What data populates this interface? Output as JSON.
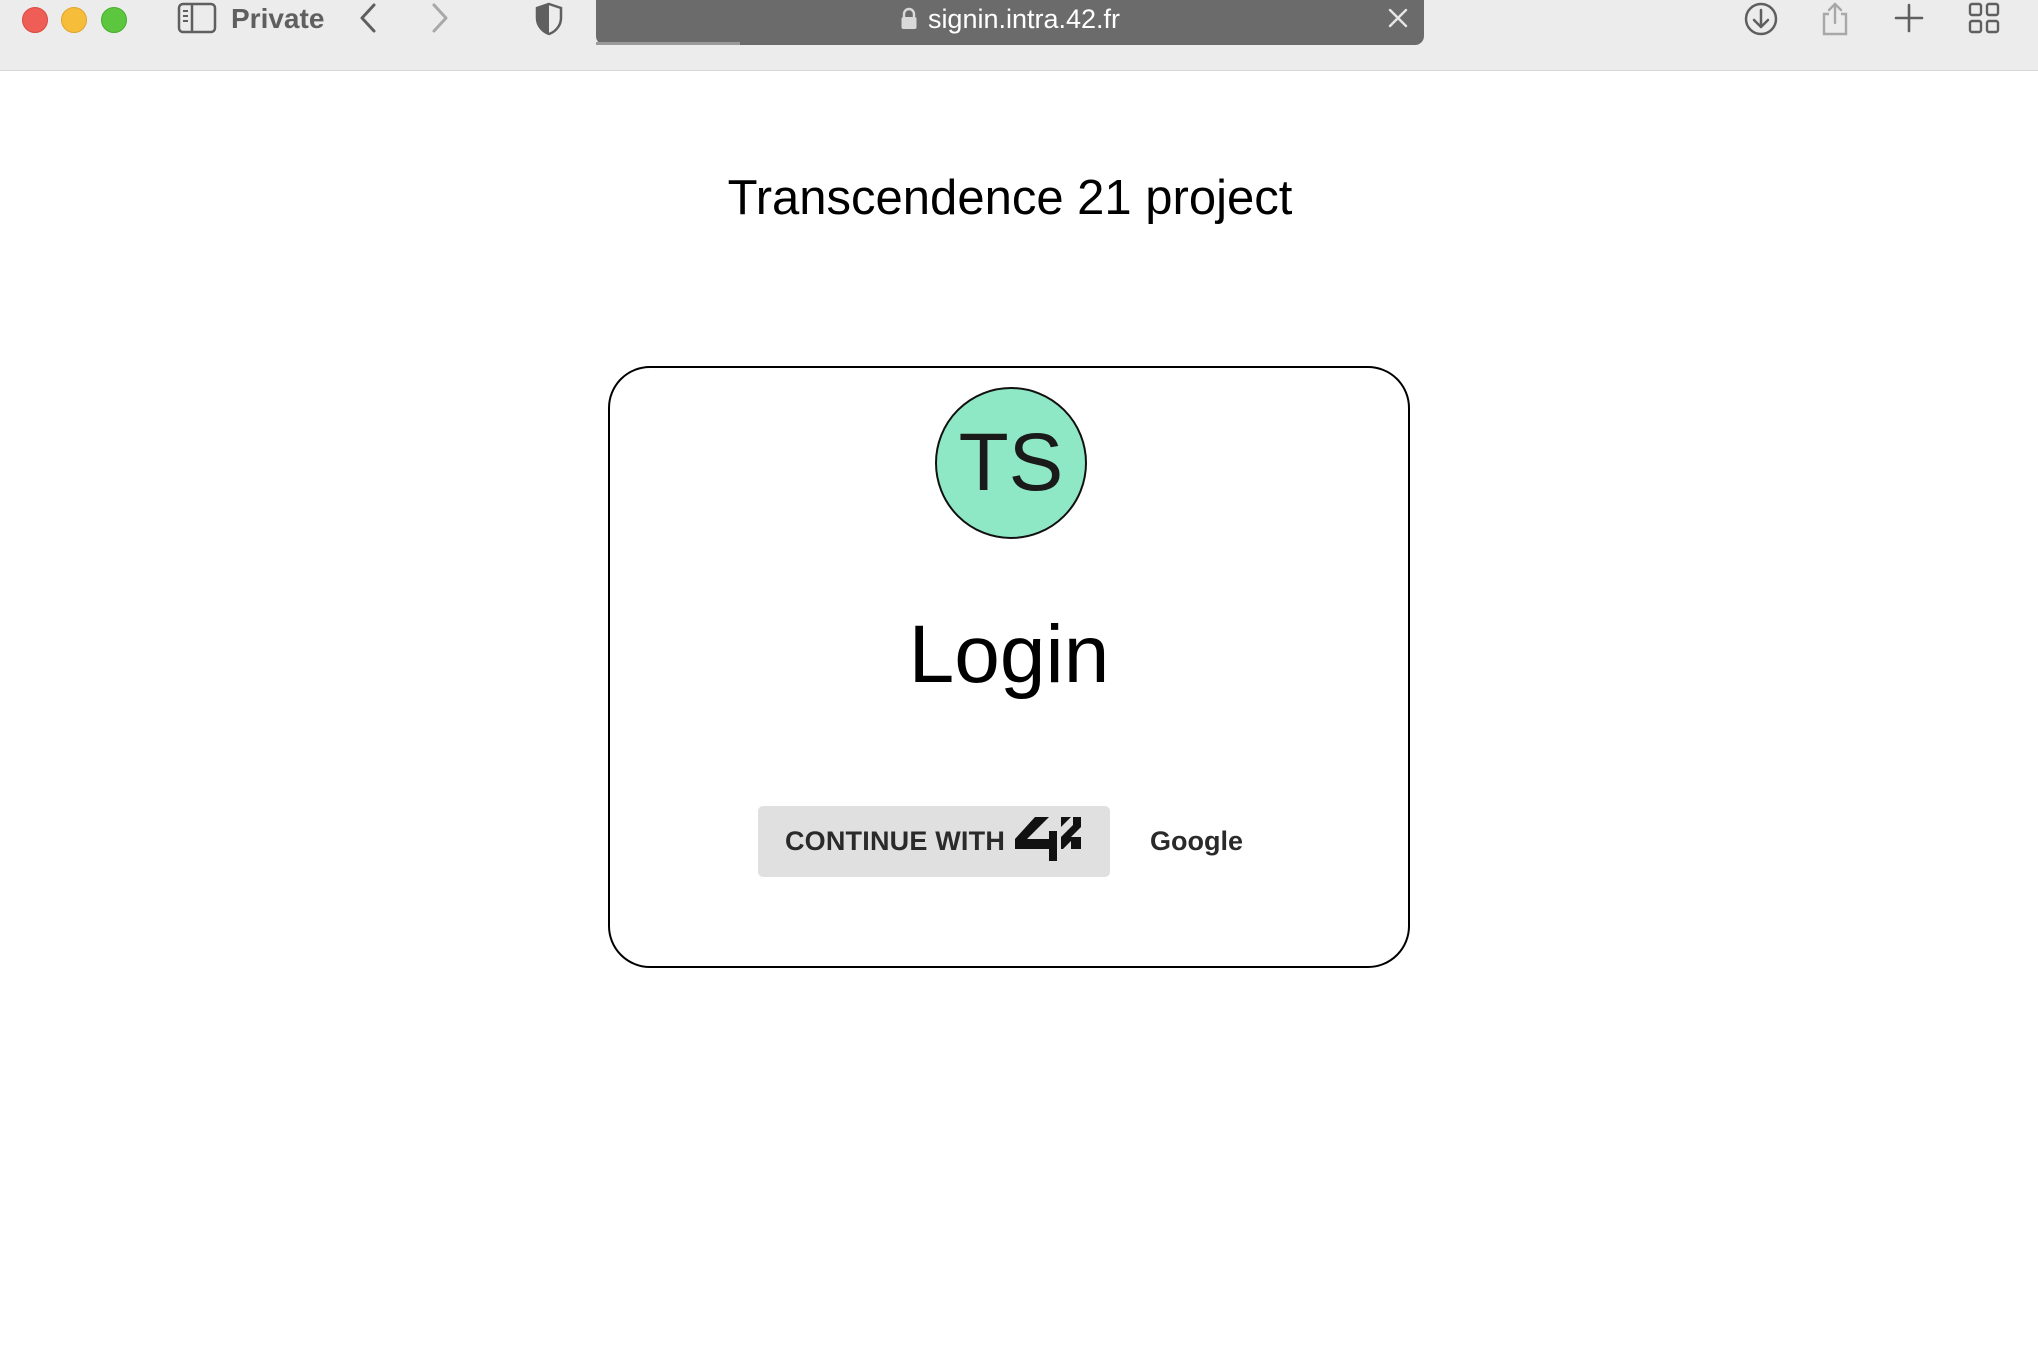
{
  "browser": {
    "mode_label": "Private",
    "url": "signin.intra.42.fr",
    "icons": {
      "sidebar": "sidebar-icon",
      "back": "chevron-left-icon",
      "forward": "chevron-right-icon",
      "privacy": "shield-icon",
      "lock": "lock-icon",
      "close": "close-icon",
      "download": "download-icon",
      "share": "share-icon",
      "new_tab": "plus-icon",
      "tab_overview": "grid-icon"
    }
  },
  "page": {
    "title": "Transcendence 21 project"
  },
  "login_card": {
    "avatar_initials": "TS",
    "avatar_color": "#8fe8c5",
    "heading": "Login",
    "buttons": {
      "continue_42_label": "CONTINUE WITH",
      "continue_42_logo": "42-logo",
      "google_label": "Google"
    }
  }
}
